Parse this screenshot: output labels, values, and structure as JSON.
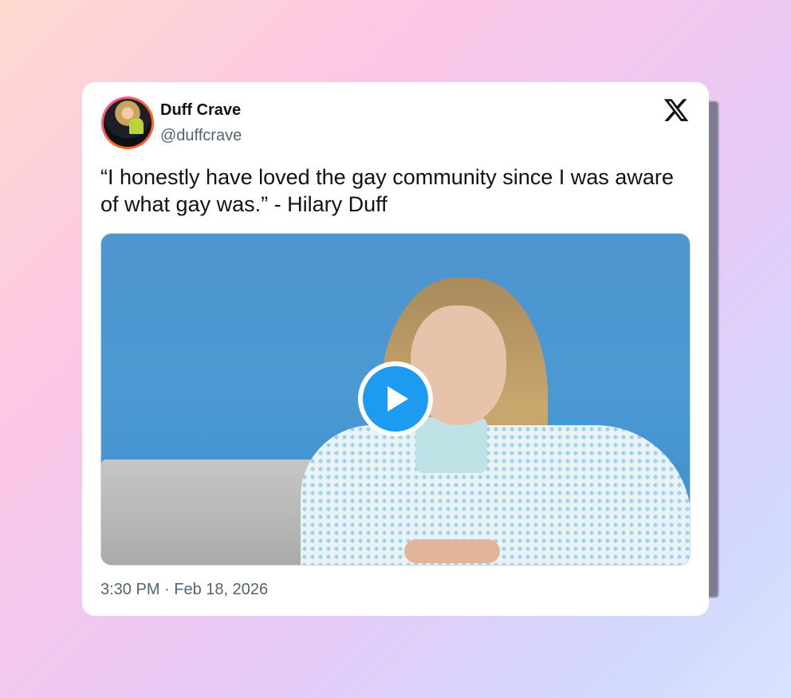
{
  "author": {
    "name": "Duff Crave",
    "handle": "@duffcrave",
    "avatar_icon": "profile-photo"
  },
  "platform_icon": "x-logo-icon",
  "tweet": {
    "text": "“I honestly have loved the gay community since I was aware of what gay was.” - Hilary Duff"
  },
  "media": {
    "type": "video",
    "play_icon": "play-icon"
  },
  "timestamp": "3:30 PM · Feb 18, 2026",
  "colors": {
    "accent": "#1d9bf0",
    "text_primary": "#0f1419",
    "text_secondary": "#536471",
    "video_background": "#4b98d2"
  }
}
